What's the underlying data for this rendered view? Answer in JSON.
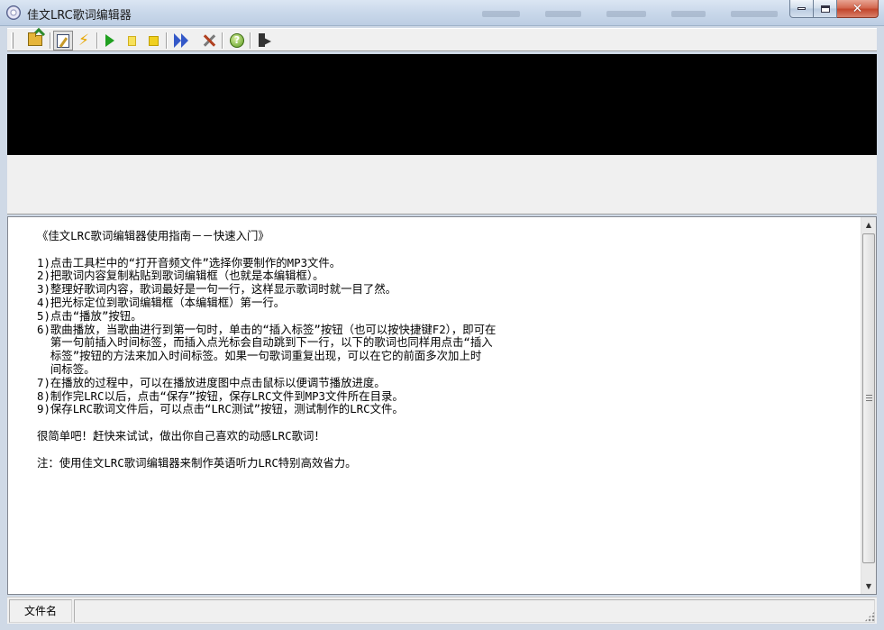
{
  "window": {
    "title": "佳文LRC歌词编辑器",
    "close_glyph": "✕"
  },
  "toolbar": {
    "buttons": [
      {
        "name": "open-audio-button",
        "icon": "folder-open-icon"
      },
      {
        "name": "edit-lyrics-button",
        "icon": "edit-icon",
        "pressed": true
      },
      {
        "name": "quick-button",
        "icon": "lightning-icon",
        "glyph": "⚡"
      },
      {
        "name": "play-button",
        "icon": "play-icon"
      },
      {
        "name": "pause-button",
        "icon": "pause-icon"
      },
      {
        "name": "stop-button",
        "icon": "stop-icon"
      },
      {
        "name": "insert-tag-button",
        "icon": "fast-forward-icon"
      },
      {
        "name": "settings-button",
        "icon": "tools-icon"
      },
      {
        "name": "help-button",
        "icon": "help-icon",
        "glyph": "?"
      },
      {
        "name": "exit-button",
        "icon": "exit-icon"
      }
    ]
  },
  "editor": {
    "lines": [
      "《佳文LRC歌词编辑器使用指南－－快速入门》",
      "",
      "1)点击工具栏中的“打开音频文件”选择你要制作的MP3文件。",
      "2)把歌词内容复制粘贴到歌词编辑框（也就是本编辑框）。",
      "3)整理好歌词内容，歌词最好是一句一行，这样显示歌词时就一目了然。",
      "4)把光标定位到歌词编辑框（本编辑框）第一行。",
      "5)点击“播放”按钮。",
      "6)歌曲播放，当歌曲进行到第一句时，单击的“插入标签”按钮（也可以按快捷键F2），即可在",
      "  第一句前插入时间标签，而插入点光标会自动跳到下一行，以下的歌词也同样用点击“插入",
      "  标签”按钮的方法来加入时间标签。如果一句歌词重复出现，可以在它的前面多次加上时",
      "  间标签。",
      "7)在播放的过程中，可以在播放进度图中点击鼠标以便调节播放进度。",
      "8)制作完LRC以后，点击“保存”按钮，保存LRC文件到MP3文件所在目录。",
      "9)保存LRC歌词文件后，可以点击“LRC测试”按钮，测试制作的LRC文件。",
      "",
      "很简单吧！赶快来试试，做出你自己喜欢的动感LRC歌词！",
      "",
      "注：使用佳文LRC歌词编辑器来制作英语听力LRC特别高效省力。"
    ],
    "scroll_up_glyph": "▲",
    "scroll_down_glyph": "▼"
  },
  "statusbar": {
    "file_label": "文件名"
  }
}
